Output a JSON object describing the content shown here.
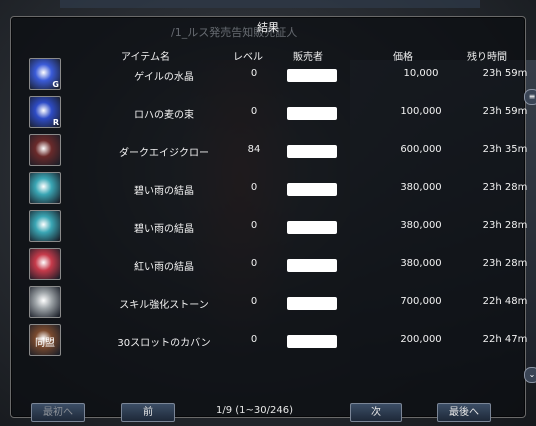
{
  "window": {
    "title": "結果",
    "background_text": "/1_ルス発売告知販売証人"
  },
  "columns": {
    "item_name": "アイテム名",
    "level": "レベル",
    "seller": "販売者",
    "price": "価格",
    "time_left": "残り時間"
  },
  "rows": [
    {
      "icon": "blue-crystal-g-icon",
      "icon_color": "#3a5bd8",
      "badge": "G",
      "name": "ゲイルの水晶",
      "level": "0",
      "price": "10,000",
      "time": "23h 59m"
    },
    {
      "icon": "blue-crystal-r-icon",
      "icon_color": "#2e4cc6",
      "badge": "R",
      "name": "ロハの麦の束",
      "level": "0",
      "price": "100,000",
      "time": "23h 59m"
    },
    {
      "icon": "dark-claw-icon",
      "icon_color": "#6a2a2a",
      "badge": "",
      "name": "ダークエイジクロー",
      "level": "84",
      "price": "600,000",
      "time": "23h 35m"
    },
    {
      "icon": "cyan-gem-icon",
      "icon_color": "#3aa6b4",
      "badge": "",
      "name": "碧い雨の結晶",
      "level": "0",
      "price": "380,000",
      "time": "23h 28m"
    },
    {
      "icon": "cyan-gem-icon",
      "icon_color": "#3aa6b4",
      "badge": "",
      "name": "碧い雨の結晶",
      "level": "0",
      "price": "380,000",
      "time": "23h 28m"
    },
    {
      "icon": "red-gem-icon",
      "icon_color": "#c63a4a",
      "badge": "",
      "name": "紅い雨の結晶",
      "level": "0",
      "price": "380,000",
      "time": "23h 28m"
    },
    {
      "icon": "skill-stone-icon",
      "icon_color": "#9ea4a8",
      "badge": "",
      "name": "スキル強化ストーン",
      "level": "0",
      "price": "700,000",
      "time": "22h 48m"
    },
    {
      "icon": "bag-icon",
      "icon_color": "#7a4a2e",
      "badge": "",
      "label": "同盟",
      "name": "30スロットのカバン",
      "level": "0",
      "price": "200,000",
      "time": "22h 47m"
    }
  ],
  "pagination": {
    "first": "最初へ",
    "prev": "前",
    "info": "1/9 (1~30/246)",
    "next": "次",
    "last": "最後へ"
  },
  "scroll": {
    "up": "≡",
    "down": "⌄"
  }
}
